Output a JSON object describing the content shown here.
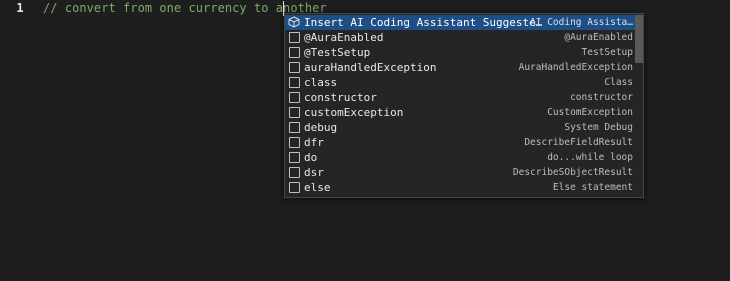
{
  "editor": {
    "line_number": "1",
    "code_text": "// convert from one currency to another"
  },
  "suggest": {
    "items": [
      {
        "label": "Insert AI Coding Assistant Suggeste…",
        "detail": "AI Coding Assista…",
        "icon": "cube-icon",
        "selected": true
      },
      {
        "label": "@AuraEnabled",
        "detail": "@AuraEnabled",
        "icon": "snippet-icon"
      },
      {
        "label": "@TestSetup",
        "detail": "TestSetup",
        "icon": "snippet-icon"
      },
      {
        "label": "auraHandledException",
        "detail": "AuraHandledException",
        "icon": "snippet-icon"
      },
      {
        "label": "class",
        "detail": "Class",
        "icon": "snippet-icon"
      },
      {
        "label": "constructor",
        "detail": "constructor",
        "icon": "snippet-icon"
      },
      {
        "label": "customException",
        "detail": "CustomException",
        "icon": "snippet-icon"
      },
      {
        "label": "debug",
        "detail": "System Debug",
        "icon": "snippet-icon"
      },
      {
        "label": "dfr",
        "detail": "DescribeFieldResult",
        "icon": "snippet-icon"
      },
      {
        "label": "do",
        "detail": "do...while loop",
        "icon": "snippet-icon"
      },
      {
        "label": "dsr",
        "detail": "DescribeSObjectResult",
        "icon": "snippet-icon"
      },
      {
        "label": "else",
        "detail": "Else statement",
        "icon": "snippet-icon"
      }
    ]
  },
  "colors": {
    "background": "#1e1e1e",
    "comment": "#7ea96a",
    "selection": "#1d4f86"
  }
}
